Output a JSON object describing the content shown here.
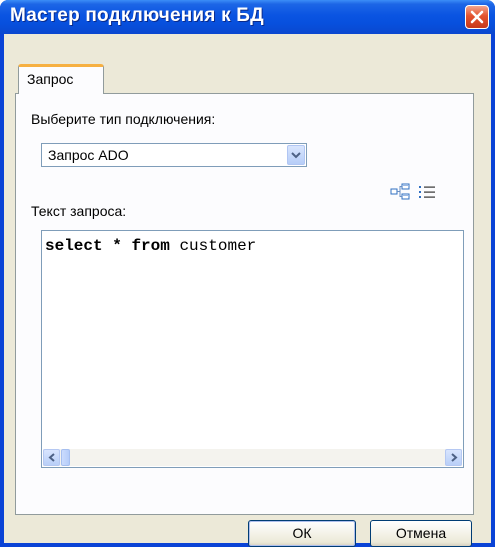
{
  "window": {
    "title": "Мастер подключения к БД"
  },
  "tabs": [
    {
      "label": "Запрос"
    }
  ],
  "connection": {
    "label": "Выберите тип подключения:",
    "selected": "Запрос ADO"
  },
  "query": {
    "label": "Текст запроса:",
    "keyword1": "select",
    "operator": "*",
    "keyword2": "from",
    "table": "customer"
  },
  "buttons": {
    "ok": "ОК",
    "cancel": "Отмена"
  },
  "icons": {
    "query_builder": "query-builder-icon",
    "field_list": "field-list-icon"
  }
}
